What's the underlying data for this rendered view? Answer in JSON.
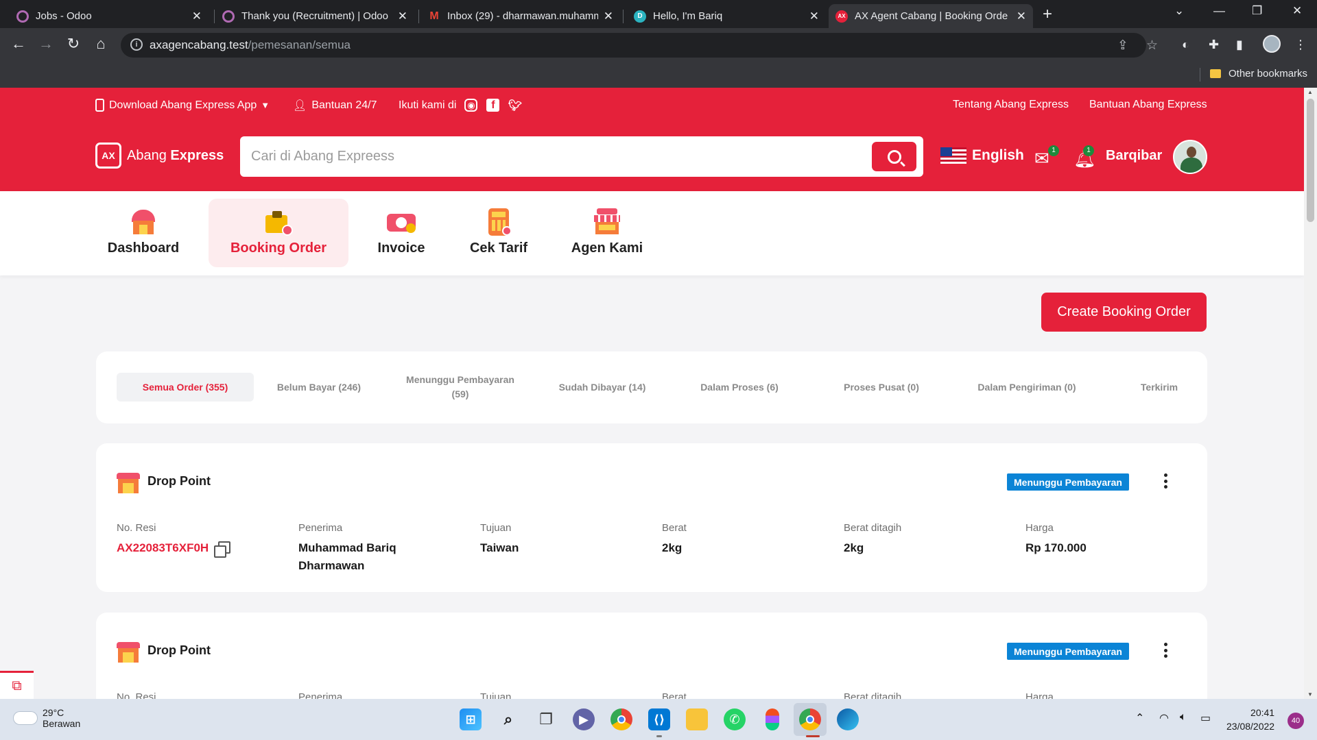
{
  "browser": {
    "tabs": [
      {
        "title": "Jobs - Odoo",
        "fav": "odoo-icon",
        "color": "#9b59b6"
      },
      {
        "title": "Thank you (Recruitment) | Odoo",
        "fav": "odoo-icon",
        "color": "#9b59b6"
      },
      {
        "title": "Inbox (29) - dharmawan.muhamm",
        "fav": "gmail-icon",
        "color": "#ea4335"
      },
      {
        "title": "Hello, I'm Bariq",
        "fav": "site-icon",
        "color": "#2bb3c0"
      },
      {
        "title": "AX Agent Cabang | Booking Orde",
        "fav": "ax-icon",
        "color": "#e5213a"
      }
    ],
    "url_host": "axagencabang.test",
    "url_path": "/pemesanan/semua",
    "bookmark": "Other bookmarks"
  },
  "topbar": {
    "download_app": "Download Abang Express App",
    "help": "Bantuan 24/7",
    "follow": "Ikuti kami di",
    "about": "Tentang Abang Express",
    "help_center": "Bantuan Abang Express",
    "logo_prefix": "Abang ",
    "logo_bold": "Express",
    "search_placeholder": "Cari di Abang Expreess",
    "language": "English",
    "mail_badge": "1",
    "notif_badge": "1",
    "username": "Barqibar"
  },
  "menu": [
    {
      "label": "Dashboard",
      "icon": "house-icon"
    },
    {
      "label": "Booking Order",
      "icon": "package-icon",
      "active": true
    },
    {
      "label": "Invoice",
      "icon": "money-icon"
    },
    {
      "label": "Cek Tarif",
      "icon": "calculator-icon"
    },
    {
      "label": "Agen Kami",
      "icon": "store-icon"
    }
  ],
  "create_button": "Create Booking Order",
  "filters": [
    {
      "label": "Semua Order (355)",
      "active": true
    },
    {
      "label": "Belum Bayar (246)"
    },
    {
      "label": "Menunggu Pembayaran (59)"
    },
    {
      "label": "Sudah Dibayar (14)"
    },
    {
      "label": "Dalam Proses (6)"
    },
    {
      "label": "Proses Pusat (0)"
    },
    {
      "label": "Dalam Pengiriman (0)"
    },
    {
      "label": "Terkirim"
    }
  ],
  "orders": [
    {
      "type": "Drop Point",
      "status": "Menunggu Pembayaran",
      "fields": {
        "resi_label": "No. Resi",
        "resi": "AX22083T6XF0H",
        "penerima_label": "Penerima",
        "penerima": "Muhammad Bariq Dharmawan",
        "tujuan_label": "Tujuan",
        "tujuan": "Taiwan",
        "berat_label": "Berat",
        "berat": "2kg",
        "ditagih_label": "Berat ditagih",
        "ditagih": "2kg",
        "harga_label": "Harga",
        "harga": "Rp 170.000"
      }
    },
    {
      "type": "Drop Point",
      "status": "Menunggu Pembayaran",
      "fields": {
        "resi_label": "No. Resi",
        "penerima_label": "Penerima",
        "tujuan_label": "Tujuan",
        "berat_label": "Berat",
        "ditagih_label": "Berat ditagih",
        "harga_label": "Harga"
      }
    }
  ],
  "taskbar": {
    "temp": "29°C",
    "weather": "Berawan",
    "time": "20:41",
    "date": "23/08/2022",
    "notifications": "40"
  },
  "colors": {
    "brand": "#e5213a",
    "status": "#0b84d6"
  }
}
